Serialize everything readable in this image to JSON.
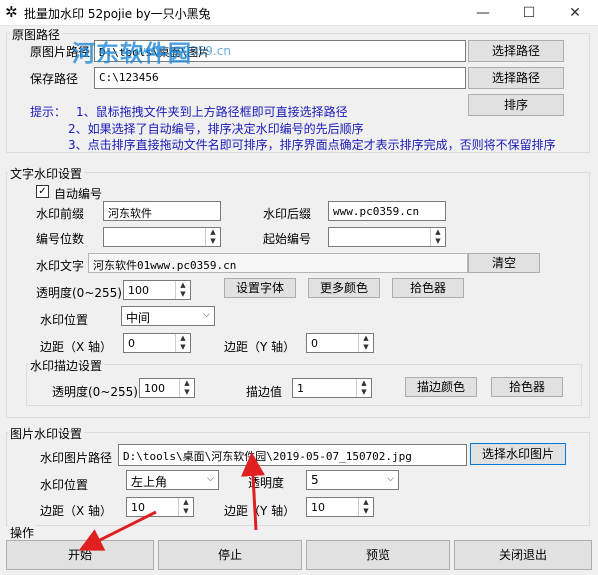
{
  "window": {
    "title": "批量加水印 52pojie by一只小黑兔",
    "minimize": "—",
    "maximize": "☐",
    "close": "✕"
  },
  "watermark_overlay": {
    "brand": "河东软件园",
    "url": "www.pc0359.cn"
  },
  "source": {
    "group_title": "原图路径",
    "orig_label": "原图片路径",
    "orig_value": "D:\\tools\\桌面\\图片",
    "orig_button": "选择路径",
    "save_label": "保存路径",
    "save_value": "C:\\123456",
    "save_button": "选择路径",
    "sort_button": "排序",
    "hint_prefix": "提示：",
    "hint1": "1、鼠标拖拽文件夹到上方路径框即可直接选择路径",
    "hint2": "2、如果选择了自动编号，排序决定水印编号的先后顺序",
    "hint3": "3、点击排序直接拖动文件名即可排序，排序界面点确定才表示排序完成，否则将不保留排序"
  },
  "text_wm": {
    "group_title": "文字水印设置",
    "auto_number_label": "自动编号",
    "auto_number_checked": true,
    "prefix_label": "水印前缀",
    "prefix_value": "河东软件",
    "suffix_label": "水印后缀",
    "suffix_value": "www.pc0359.cn",
    "digits_label": "编号位数",
    "digits_value": "",
    "start_label": "起始编号",
    "start_value": "",
    "text_label": "水印文字",
    "text_value": "河东软件01www.pc0359.cn",
    "clear_button": "清空",
    "opacity_label": "透明度(0~255)",
    "opacity_value": "100",
    "font_button": "设置字体",
    "color_button": "更多颜色",
    "picker_button": "拾色器",
    "position_label": "水印位置",
    "position_value": "中间",
    "margin_x_label": "边距（X 轴）",
    "margin_x_value": "0",
    "margin_y_label": "边距（Y 轴）",
    "margin_y_value": "0"
  },
  "stroke": {
    "group_title": "水印描边设置",
    "opacity_label": "透明度(0~255)",
    "opacity_value": "100",
    "stroke_label": "描边值",
    "stroke_value": "1",
    "color_button": "描边颜色",
    "picker_button": "拾色器"
  },
  "image_wm": {
    "group_title": "图片水印设置",
    "path_label": "水印图片路径",
    "path_value": "D:\\tools\\桌面\\河东软件园\\2019-05-07_150702.jpg",
    "select_button": "选择水印图片",
    "position_label": "水印位置",
    "position_value": "左上角",
    "opacity_label": "透明度",
    "opacity_value": "5",
    "margin_x_label": "边距（X 轴）",
    "margin_x_value": "10",
    "margin_y_label": "边距（Y 轴）",
    "margin_y_value": "10"
  },
  "actions": {
    "group_title": "操作",
    "start": "开始",
    "stop": "停止",
    "preview": "预览",
    "close": "关闭退出"
  },
  "colors": {
    "hint_blue": "#1a1ab8",
    "annotation_red": "#e02020",
    "focus_blue": "#0078d7"
  }
}
